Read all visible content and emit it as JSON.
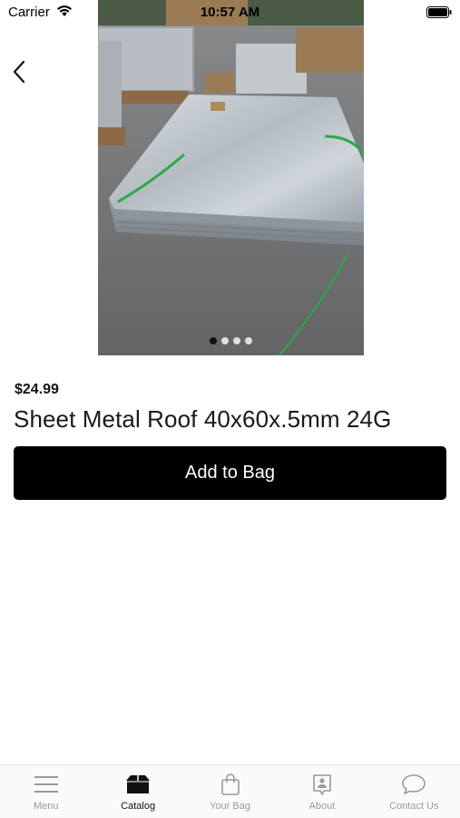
{
  "status_bar": {
    "carrier": "Carrier",
    "time": "10:57 AM"
  },
  "product": {
    "price": "$24.99",
    "title": "Sheet Metal Roof 40x60x.5mm 24G",
    "image_pages": 4,
    "active_page": 1
  },
  "actions": {
    "add_to_bag": "Add to Bag"
  },
  "tabs": [
    {
      "label": "Menu",
      "icon": "menu-icon",
      "active": false
    },
    {
      "label": "Catalog",
      "icon": "catalog-icon",
      "active": true
    },
    {
      "label": "Your Bag",
      "icon": "bag-icon",
      "active": false
    },
    {
      "label": "About",
      "icon": "about-icon",
      "active": false
    },
    {
      "label": "Contact Us",
      "icon": "chat-icon",
      "active": false
    }
  ],
  "colors": {
    "button_bg": "#000000",
    "button_text": "#ffffff",
    "tab_active": "#111111",
    "tab_inactive": "#9a9a9a"
  }
}
